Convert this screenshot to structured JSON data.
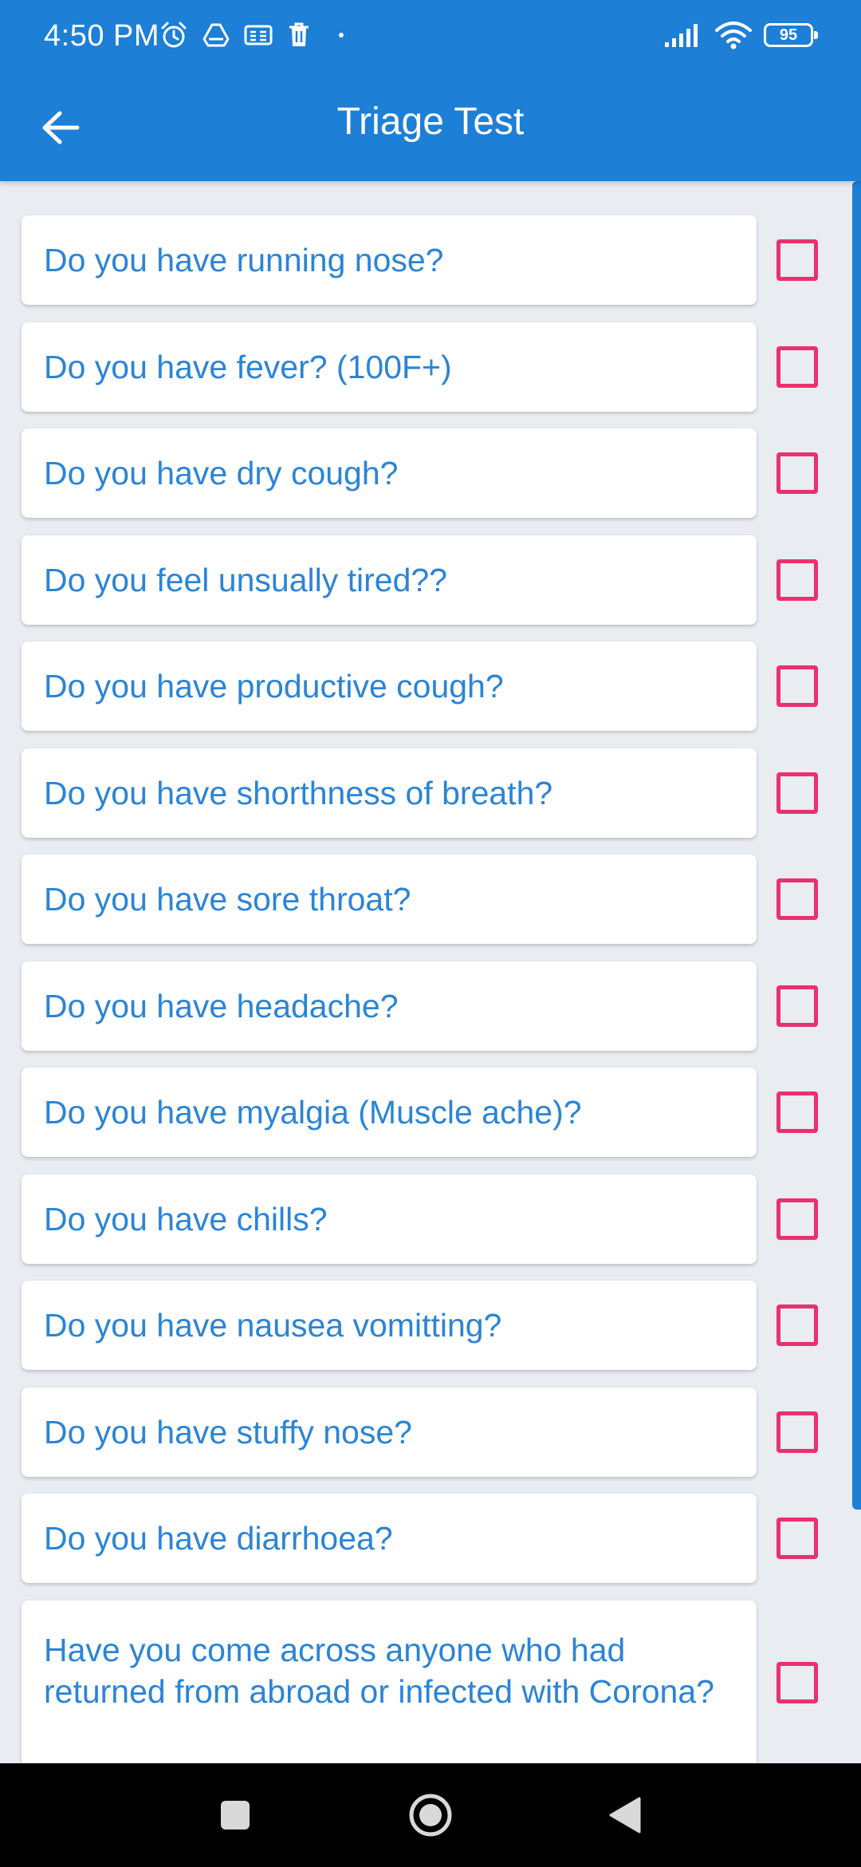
{
  "status_bar": {
    "time": "4:50 PM",
    "battery": "95",
    "left_icons": [
      "alarm-icon",
      "drive-icon",
      "sim-card-icon",
      "delete-icon",
      "dot-icon"
    ],
    "right_icons": [
      "signal-icon",
      "wifi-icon",
      "battery-icon"
    ]
  },
  "app_bar": {
    "title": "Triage Test",
    "back_icon": "arrow-left-icon"
  },
  "questions": [
    {
      "text": "Do you have running nose?",
      "checked": false
    },
    {
      "text": "Do you have fever? (100F+)",
      "checked": false
    },
    {
      "text": "Do you have dry cough?",
      "checked": false
    },
    {
      "text": "Do you feel unsually tired??",
      "checked": false
    },
    {
      "text": "Do you have productive cough?",
      "checked": false
    },
    {
      "text": "Do you have shorthness of breath?",
      "checked": false
    },
    {
      "text": "Do you have sore throat?",
      "checked": false
    },
    {
      "text": "Do you have headache?",
      "checked": false
    },
    {
      "text": "Do you have myalgia (Muscle ache)?",
      "checked": false
    },
    {
      "text": "Do you have chills?",
      "checked": false
    },
    {
      "text": "Do you have nausea vomitting?",
      "checked": false
    },
    {
      "text": "Do you have stuffy nose?",
      "checked": false
    },
    {
      "text": "Do you have diarrhoea?",
      "checked": false
    },
    {
      "text": "Have you come across anyone who had returned from abroad or infected with Corona?",
      "checked": false
    }
  ],
  "colors": {
    "primary": "#1d7fd5",
    "question_text": "#2b84d6",
    "checkbox_border": "#e8316f",
    "background": "#e9ecf1",
    "nav_bar": "#000000"
  },
  "nav_bar": {
    "icons": [
      "recents-icon",
      "home-icon",
      "back-icon"
    ]
  }
}
